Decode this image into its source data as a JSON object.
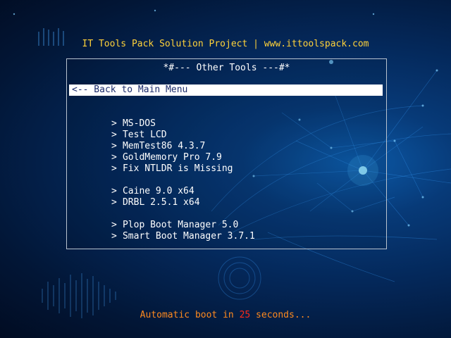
{
  "header": {
    "title": "IT Tools Pack Solution Project | www.ittoolspack.com"
  },
  "menu": {
    "title": "*#--- Other Tools ---#*",
    "back_label": "<-- Back to Main Menu",
    "chevron": ">",
    "items": [
      "MS-DOS",
      "Test LCD",
      "MemTest86 4.3.7",
      "GoldMemory Pro 7.9",
      "Fix NTLDR is Missing",
      "Caine 9.0 x64",
      "DRBL 2.5.1 x64",
      "Plop Boot Manager 5.0",
      "Smart Boot Manager 3.7.1"
    ]
  },
  "footer": {
    "prefix": "Automatic boot in ",
    "seconds": "25",
    "suffix": " seconds..."
  },
  "colors": {
    "header_text": "#ffd23a",
    "menu_text": "#ffffff",
    "selected_bg": "#ffffff",
    "selected_text": "#1a2a6a",
    "footer_text": "#ff8a1e",
    "countdown": "#ff2a1a",
    "background": "#04285a"
  }
}
